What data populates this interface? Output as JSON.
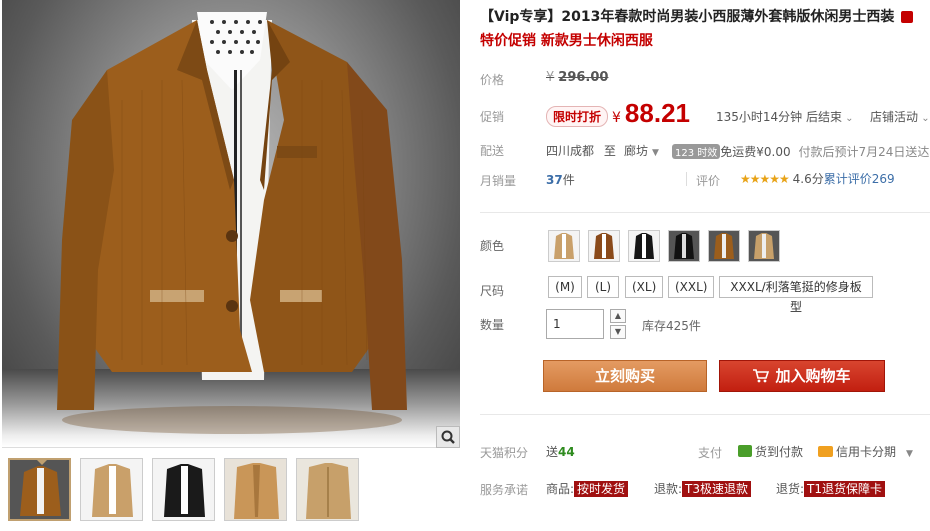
{
  "product": {
    "title": "【Vip专享】2013年春款时尚男装小西服薄外套韩版休闲男士西装",
    "subtitle": "特价促销 新款男士休闲西服",
    "title_icon": "gift-icon"
  },
  "price": {
    "label": "价格",
    "currency": "¥",
    "original": "296.00"
  },
  "promo": {
    "label": "促销",
    "badge": "限时打折",
    "currency": "¥",
    "price": "88.21",
    "countdown": "135小时14分钟 后结束",
    "shop_activity": "店铺活动"
  },
  "shipping": {
    "label": "配送",
    "from": "四川成都",
    "to_word": "至",
    "to": "廊坊",
    "hours_badge": "123 时效",
    "free_shipping": "免运费",
    "fee": "¥0.00",
    "eta": "付款后预计7月24日送达"
  },
  "sales": {
    "label": "月销量",
    "count": "37",
    "unit": "件",
    "rating_label": "评价",
    "stars": "★★★★★",
    "score": "4.6分",
    "reviews": "累计评价269"
  },
  "color": {
    "label": "颜色",
    "swatches": [
      "camel",
      "brown",
      "black",
      "black-dark",
      "orange-brown",
      "khaki"
    ]
  },
  "size": {
    "label": "尺码",
    "options": [
      "(M)",
      "(L)",
      "(XL)",
      "(XXL)",
      "XXXL/利落笔挺的修身板型"
    ]
  },
  "quantity": {
    "label": "数量",
    "value": "1",
    "stock": "库存425件"
  },
  "actions": {
    "buy": "立刻购买",
    "cart": "加入购物车"
  },
  "points": {
    "label": "天猫积分",
    "send": "送",
    "amount": "44",
    "pay_label": "支付",
    "cod": "货到付款",
    "installment": "信用卡分期"
  },
  "service": {
    "label": "服务承诺",
    "goods_label": "商品:",
    "goods_tag": "按时发货",
    "refund_label": "退款:",
    "refund_tag": "T3极速退款",
    "return_label": "退货:",
    "return_tag": "T1退货保障卡"
  },
  "colors": {
    "accent_red": "#c40000",
    "buy_orange": "#d8874b",
    "cart_red": "#cc2a18",
    "jacket": "#9c5e1c"
  }
}
